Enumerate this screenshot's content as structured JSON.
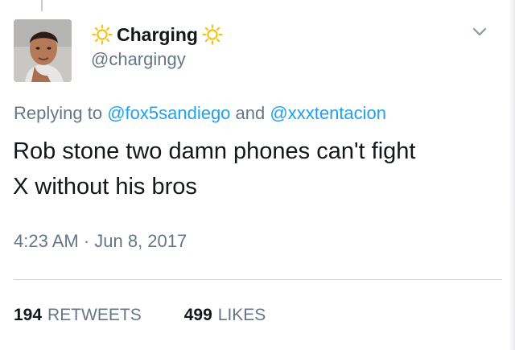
{
  "tweet": {
    "display_name": "Charging",
    "handle": "@chargingy",
    "reply_prefix": "Replying to",
    "reply_mention_1": "@fox5sandiego",
    "reply_and": "and",
    "reply_mention_2": "@xxxtentacion",
    "text_line_1": "Rob stone two damn phones can't fight",
    "text_line_2": "X without his bros",
    "timestamp": "4:23 AM · Jun 8, 2017",
    "retweets_count": "194",
    "retweets_label": "RETWEETS",
    "likes_count": "499",
    "likes_label": "LIKES"
  },
  "icons": {
    "name_decoration_left": "sun-icon",
    "name_decoration_right": "sun-icon",
    "menu": "chevron-down-icon"
  },
  "colors": {
    "link": "#1da1f2",
    "secondary_text": "#657786",
    "primary_text": "#14171a",
    "sun": "#f4c21a"
  }
}
